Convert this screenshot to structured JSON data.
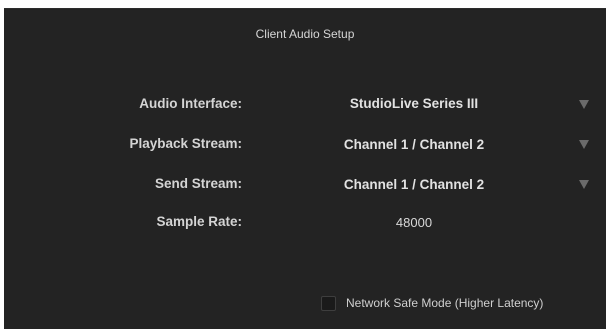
{
  "dialog": {
    "title": "Client Audio Setup"
  },
  "audio_interface": {
    "label": "Audio Interface:",
    "value": "StudioLive Series III"
  },
  "playback_stream": {
    "label": "Playback Stream:",
    "value": "Channel 1 / Channel 2"
  },
  "send_stream": {
    "label": "Send Stream:",
    "value": "Channel 1 / Channel 2"
  },
  "sample_rate": {
    "label": "Sample Rate:",
    "value": "48000"
  },
  "network_safe_mode": {
    "label": "Network Safe Mode (Higher Latency)",
    "checked": false
  },
  "icons": {
    "dropdown": "chevron-down-icon"
  },
  "colors": {
    "background": "#232323",
    "text": "#d4d4d4",
    "arrow": "#6b6b6b"
  }
}
